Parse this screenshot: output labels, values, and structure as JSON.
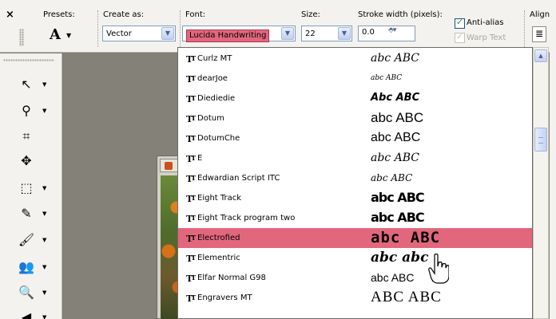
{
  "toolbar": {
    "presets_label": "Presets:",
    "preset_glyph": "A",
    "create_as_label": "Create as:",
    "create_as_value": "Vector",
    "font_label": "Font:",
    "font_value": "Lucida Handwriting",
    "size_label": "Size:",
    "size_value": "22",
    "stroke_label": "Stroke width (pixels):",
    "stroke_value": "0.0",
    "anti_alias_label": "Anti-alias",
    "anti_alias_checked": true,
    "warp_text_label": "Warp Text",
    "warp_text_enabled": false,
    "align_label": "Align",
    "close_glyph": "×"
  },
  "tools": [
    {
      "name": "pointer-tool",
      "glyph": "↖"
    },
    {
      "name": "zoom-pan-tool",
      "glyph": "⚲"
    },
    {
      "name": "crop-tool",
      "glyph": "⌗"
    },
    {
      "name": "move-tool",
      "glyph": "✥"
    },
    {
      "name": "selection-tool",
      "glyph": "⬚"
    },
    {
      "name": "dropper-tool",
      "glyph": "✎"
    },
    {
      "name": "paint-brush-tool",
      "glyph": "🖌"
    },
    {
      "name": "clone-brush-tool",
      "glyph": "👥"
    },
    {
      "name": "zoom-tool",
      "glyph": "🔍"
    },
    {
      "name": "eraser-tool",
      "glyph": "◀"
    }
  ],
  "font_list": {
    "accent_color": "#e2677d",
    "items": [
      {
        "name": "Curlz MT",
        "sample": "abc ABC",
        "selected": false
      },
      {
        "name": "dearJoe",
        "sample": "abc ABC",
        "selected": false
      },
      {
        "name": "Diediedie",
        "sample": "Abc ABC",
        "selected": false
      },
      {
        "name": "Dotum",
        "sample": "abc ABC",
        "selected": false
      },
      {
        "name": "DotumChe",
        "sample": "abc ABC",
        "selected": false
      },
      {
        "name": "E",
        "sample": "abc ABC",
        "selected": false
      },
      {
        "name": "Edwardian Script ITC",
        "sample": "abc ABC",
        "selected": false
      },
      {
        "name": "Eight Track",
        "sample": "abc ABC",
        "selected": false
      },
      {
        "name": "Eight Track program two",
        "sample": "abc ABC",
        "selected": false
      },
      {
        "name": "Electrofied",
        "sample": "abc ABC",
        "selected": true
      },
      {
        "name": "Elementric",
        "sample": "abc abc",
        "selected": false
      },
      {
        "name": "Elfar Normal G98",
        "sample": "abc ABC",
        "selected": false
      },
      {
        "name": "Engravers MT",
        "sample": "ABC ABC",
        "selected": false
      }
    ]
  }
}
